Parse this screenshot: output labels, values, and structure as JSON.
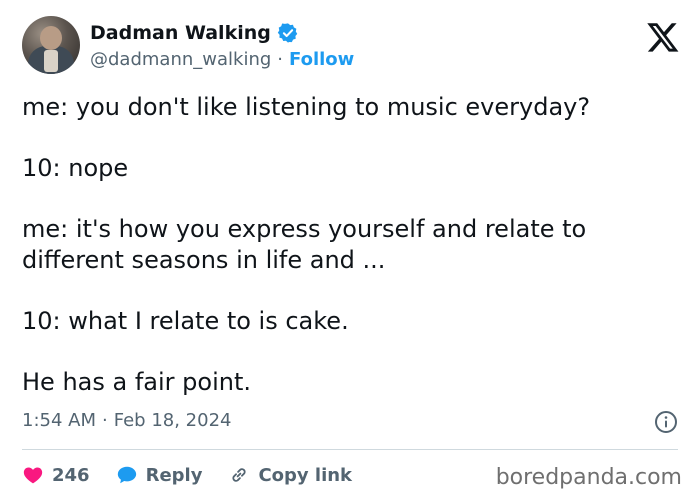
{
  "author": {
    "name": "Dadman Walking",
    "handle": "@dadmann_walking",
    "separator": "·",
    "follow_label": "Follow"
  },
  "tweet": {
    "lines": [
      "me: you don't like listening to music everyday?",
      "10: nope",
      "me: it's how you express yourself and relate to different seasons in life and ...",
      "10: what I relate to is cake.",
      "He has a fair point."
    ],
    "time": "1:54 AM",
    "separator": "·",
    "date": "Feb 18, 2024"
  },
  "actions": {
    "like_count": "246",
    "reply_label": "Reply",
    "copy_label": "Copy link"
  },
  "watermark": "boredpanda.com",
  "colors": {
    "accent": "#1d9bf0",
    "like": "#f91880",
    "text": "#0f1419",
    "muted": "#536471"
  },
  "icons": [
    "verified-badge-icon",
    "x-logo-icon",
    "info-icon",
    "heart-icon",
    "reply-bubble-icon",
    "link-icon"
  ]
}
